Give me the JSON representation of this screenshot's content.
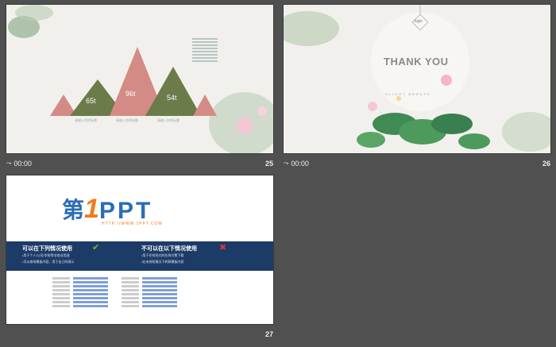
{
  "slides": [
    {
      "number": "25",
      "time": "00:00",
      "peaks": [
        {
          "value": "65t",
          "caption": "请输入你的标题"
        },
        {
          "value": "96t",
          "caption": "请输入你的标题"
        },
        {
          "value": "54t",
          "caption": "请输入你的标题"
        }
      ]
    },
    {
      "number": "26",
      "time": "00:00",
      "logo": "logo",
      "title": "THANK YOU",
      "subtitle": "SLIGHT  BREATH"
    },
    {
      "number": "27",
      "brand": {
        "text1": "第",
        "text2": "1",
        "text3": "PPT",
        "url": "HTTP://WWW.1PPT.COM"
      },
      "allowed_title": "可以在下列情况使用",
      "forbidden_title": "不可以在以下情况使用",
      "allowed_items": [
        "•用于个人/公司/学校等非商业用途",
        "•可以修改模板内容，用于自己的演示"
      ],
      "forbidden_items": [
        "•用于任何形式的在线付费下载",
        "•在未授权情况下转载模板内容"
      ]
    }
  ],
  "colors": {
    "background": "#505050",
    "band": "#1d3b67",
    "peak_green": "#6b7b4a",
    "peak_pink": "#d48a85",
    "check": "#6abf3a",
    "cross": "#d23838"
  }
}
